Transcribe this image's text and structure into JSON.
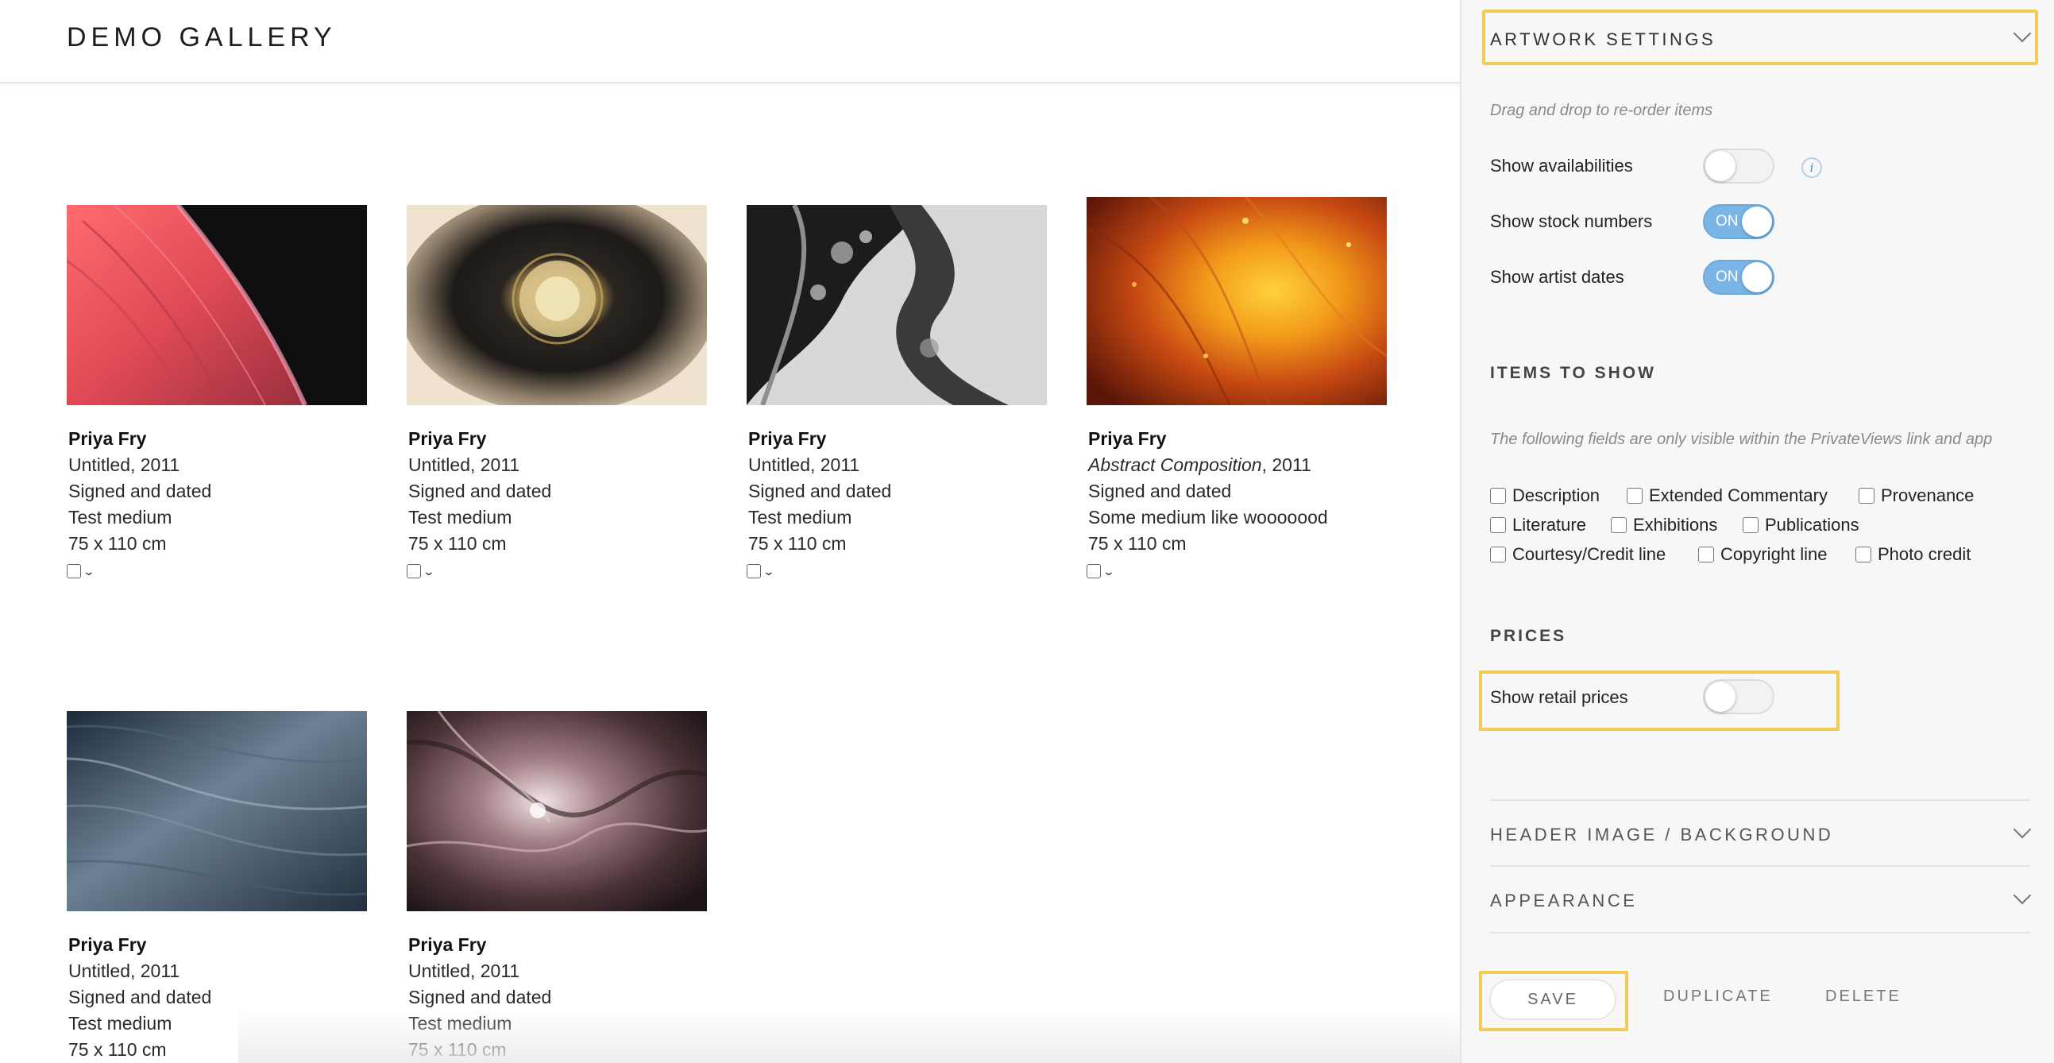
{
  "gallery": {
    "title": "DEMO GALLERY",
    "artworks": [
      {
        "artist": "Priya Fry",
        "title": "Untitled",
        "year": ", 2011",
        "signed": "Signed and dated",
        "medium": "Test medium",
        "size": "75 x 110 cm",
        "image": "red-fluid-art"
      },
      {
        "artist": "Priya Fry",
        "title": "Untitled",
        "year": ", 2011",
        "signed": "Signed and dated",
        "medium": "Test medium",
        "size": "75 x 110 cm",
        "image": "gold-bubble-art"
      },
      {
        "artist": "Priya Fry",
        "title": "Untitled",
        "year": ", 2011",
        "signed": "Signed and dated",
        "medium": "Test medium",
        "size": "75 x 110 cm",
        "image": "monochrome-fluid-art"
      },
      {
        "artist": "Priya Fry",
        "title": "Abstract Composition",
        "year": ", 2011",
        "signed": "Signed and dated",
        "medium": "Some medium like wooooood",
        "size": "75 x 110 cm",
        "image": "orange-fluid-art"
      },
      {
        "artist": "Priya Fry",
        "title": "Untitled",
        "year": ", 2011",
        "signed": "Signed and dated",
        "medium": "Test medium",
        "size": "75 x 110 cm",
        "image": "blue-grey-fluid-art"
      },
      {
        "artist": "Priya Fry",
        "title": "Untitled",
        "year": ", 2011",
        "signed": "Signed and dated",
        "medium": "Test medium",
        "size": "75 x 110 cm",
        "image": "mauve-fluid-art"
      }
    ]
  },
  "panel": {
    "artwork_settings": {
      "header": "ARTWORK SETTINGS",
      "hint": "Drag and drop to re-order items",
      "toggles": [
        {
          "label": "Show availabilities",
          "state": "off",
          "on_text": ""
        },
        {
          "label": "Show stock numbers",
          "state": "on",
          "on_text": "ON"
        },
        {
          "label": "Show artist dates",
          "state": "on",
          "on_text": "ON"
        }
      ]
    },
    "items_to_show": {
      "title": "ITEMS TO SHOW",
      "hint": "The following fields are only visible within the PrivateViews link and app",
      "options": [
        "Description",
        "Extended Commentary",
        "Provenance",
        "Literature",
        "Exhibitions",
        "Publications",
        "Courtesy/Credit line",
        "Copyright line",
        "Photo credit"
      ]
    },
    "prices": {
      "title": "PRICES",
      "retail_label": "Show retail prices",
      "retail_state": "off"
    },
    "accordions": {
      "header_image": "HEADER IMAGE / BACKGROUND",
      "appearance": "APPEARANCE"
    },
    "actions": {
      "save": "SAVE",
      "duplicate": "DUPLICATE",
      "delete": "DELETE"
    }
  },
  "colors": {
    "highlight": "#f3cc57",
    "toggle_on": "#7ab5e6",
    "panel_bg": "#f7f7f7"
  }
}
